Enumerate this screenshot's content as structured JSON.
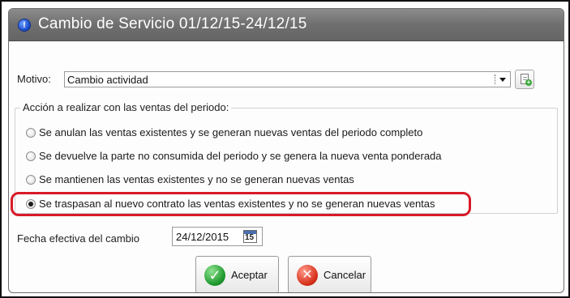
{
  "window": {
    "title": "Cambio de Servicio 01/12/15-24/12/15",
    "title_icon": "info-icon"
  },
  "motivo": {
    "label": "Motivo:",
    "value": "Cambio actividad",
    "side_button_icon": "new-document-icon"
  },
  "accion": {
    "title": "Acción a realizar con las ventas del periodo:",
    "options": [
      {
        "label": "Se anulan las ventas existentes y se generan nuevas ventas del periodo completo",
        "selected": false
      },
      {
        "label": "Se devuelve la parte no consumida del periodo y se genera la nueva venta ponderada",
        "selected": false
      },
      {
        "label": "Se mantienen las ventas existentes y no se generan nuevas ventas",
        "selected": false
      },
      {
        "label": "Se traspasan al nuevo contrato las ventas existentes y no se generan nuevas ventas",
        "selected": true
      }
    ],
    "highlight_color": "#d81b27"
  },
  "fecha": {
    "label": "Fecha efectiva del cambio",
    "value": "24/12/2015",
    "calendar_day": "15",
    "calendar_icon": "calendar-icon"
  },
  "buttons": {
    "accept_label": "Aceptar",
    "accept_icon": "check-icon",
    "cancel_label": "Cancelar",
    "cancel_icon": "cancel-icon"
  },
  "colors": {
    "titlebar": "#6f6f6f",
    "accept": "#1f9a2f",
    "cancel": "#d8321c"
  }
}
